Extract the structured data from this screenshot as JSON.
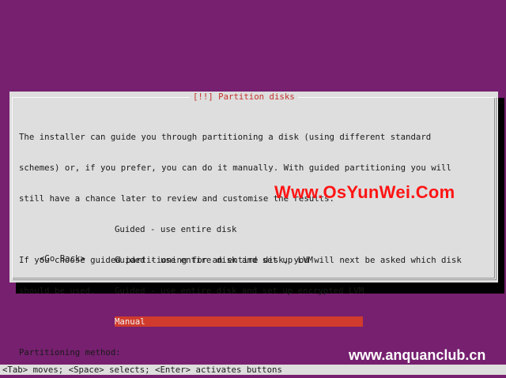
{
  "dialog": {
    "title": "[!!] Partition disks",
    "intro_line_1": "The installer can guide you through partitioning a disk (using different standard",
    "intro_line_2": "schemes) or, if you prefer, you can do it manually. With guided partitioning you will",
    "intro_line_3": "still have a chance later to review and customise the results.",
    "guided_line_1": "If you choose guided partitioning for an entire disk, you will next be asked which disk",
    "guided_line_2": "should be used.",
    "method_label": "Partitioning method:",
    "options": [
      {
        "label": "Guided - use entire disk",
        "selected": false
      },
      {
        "label": "Guided - use entire disk and set up LVM",
        "selected": false
      },
      {
        "label": "Guided - use entire disk and set up encrypted LVM",
        "selected": false
      },
      {
        "label": "Manual",
        "selected": true
      }
    ],
    "go_back": "<Go Back>"
  },
  "status_bar": {
    "text": "<Tab> moves; <Space> selects; <Enter> activates buttons"
  },
  "watermarks": {
    "top": "Www.OsYunWei.Com",
    "bottom": "www.anquanclub.cn"
  },
  "colors": {
    "background": "#76206f",
    "dialog": "#dedede",
    "selection": "#d03b2d",
    "title_text": "#c4302a"
  }
}
